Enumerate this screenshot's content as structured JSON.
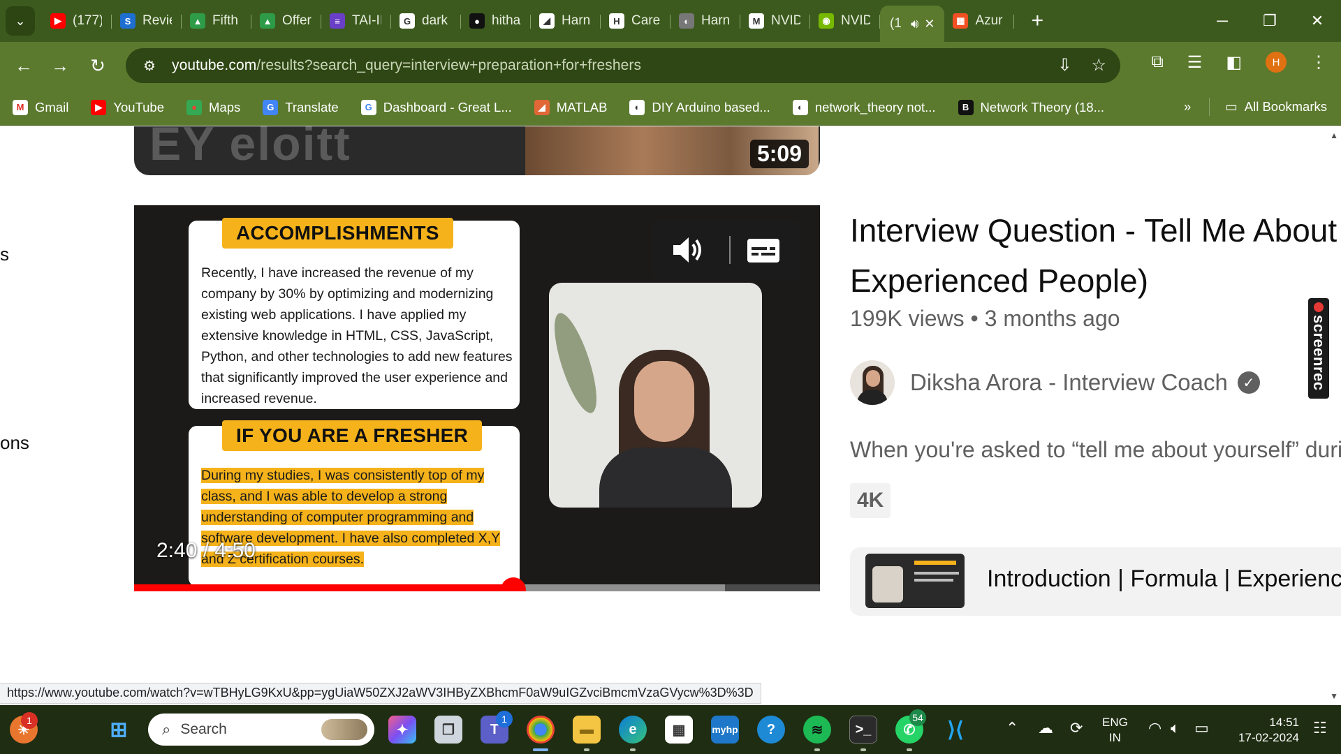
{
  "browser": {
    "tabs": [
      {
        "title": "(177)",
        "icon": "youtube-icon",
        "color": "#ff0000",
        "glyph": "▶"
      },
      {
        "title": "Revie",
        "icon": "s-logo-icon",
        "color": "#1f6fd1",
        "glyph": "S"
      },
      {
        "title": "Fifth",
        "icon": "drive-icon",
        "color": "#2d9b48",
        "glyph": "▲"
      },
      {
        "title": "Offer",
        "icon": "drive-icon",
        "color": "#2d9b48",
        "glyph": "▲"
      },
      {
        "title": "TAI-II",
        "icon": "forms-icon",
        "color": "#6a3fc7",
        "glyph": "≡"
      },
      {
        "title": "dark",
        "icon": "google-icon",
        "color": "#ffffff",
        "glyph": "G"
      },
      {
        "title": "hitha",
        "icon": "github-icon",
        "color": "#111111",
        "glyph": "●"
      },
      {
        "title": "Harn",
        "icon": "harness-icon",
        "color": "#ffffff",
        "glyph": "◢"
      },
      {
        "title": "Care",
        "icon": "h-logo-icon",
        "color": "#ffffff",
        "glyph": "H"
      },
      {
        "title": "Harn",
        "icon": "globe-icon",
        "color": "#777777",
        "glyph": "◐"
      },
      {
        "title": "NVID",
        "icon": "gmail-icon",
        "color": "#ffffff",
        "glyph": "M"
      },
      {
        "title": "NVID",
        "icon": "nvidia-icon",
        "color": "#76b900",
        "glyph": "◉"
      },
      {
        "title": "(1",
        "icon": "speaker-icon",
        "color": "#5b7a2e",
        "glyph": "",
        "active": true
      },
      {
        "title": "Azur",
        "icon": "microsoft-icon",
        "color": "#f25022",
        "glyph": "▦"
      }
    ],
    "url_host": "youtube.com",
    "url_path": "/results?search_query=interview+preparation+for+freshers",
    "bookmarks": [
      {
        "label": "Gmail",
        "icon": "gmail-icon",
        "color": "#ffffff",
        "glyph": "M",
        "fg": "#d93025"
      },
      {
        "label": "YouTube",
        "icon": "youtube-icon",
        "color": "#ff0000",
        "glyph": "▶",
        "fg": "#ffffff"
      },
      {
        "label": "Maps",
        "icon": "maps-icon",
        "color": "#34a853",
        "glyph": "●",
        "fg": "#ea4335"
      },
      {
        "label": "Translate",
        "icon": "translate-icon",
        "color": "#4285f4",
        "glyph": "G",
        "fg": "#ffffff"
      },
      {
        "label": "Dashboard - Great L...",
        "icon": "google-icon",
        "color": "#ffffff",
        "glyph": "G",
        "fg": "#4285f4"
      },
      {
        "label": "MATLAB",
        "icon": "matlab-icon",
        "color": "#e16737",
        "glyph": "◢",
        "fg": "#ffffff"
      },
      {
        "label": "DIY Arduino based...",
        "icon": "globe-icon",
        "color": "#ffffff",
        "glyph": "◐",
        "fg": "#333333"
      },
      {
        "label": "network_theory not...",
        "icon": "globe-icon",
        "color": "#ffffff",
        "glyph": "◐",
        "fg": "#333333"
      },
      {
        "label": "Network Theory (18...",
        "icon": "b-logo-icon",
        "color": "#111111",
        "glyph": "B",
        "fg": "#ffffff"
      }
    ],
    "all_bookmarks": "All Bookmarks",
    "profile_initial": "H"
  },
  "page": {
    "edge_texts": [
      "s",
      "ons"
    ],
    "prev_duration": "5:09",
    "prev_thumb_text": "EY   eloitt",
    "player": {
      "card_a_label": "ACCOMPLISHMENTS",
      "card_a_text": "Recently, I have increased the revenue of my company by 30% by optimizing and modernizing existing web applications. I have applied my extensive knowledge in HTML, CSS, JavaScript, Python, and other technologies to add new features that significantly improved the user experience and increased revenue.",
      "card_b_label": "IF YOU ARE A FRESHER",
      "card_b_text": "During my studies, I was consistently top of my class, and I was able to develop a strong understanding of computer programming and software development. I have also completed X,Y and Z certification courses.",
      "current_time": "2:40",
      "separator": "/",
      "total_time": "4:50",
      "played_fraction": 0.553,
      "buffered_fraction": 0.862
    },
    "video": {
      "title": "Interview Question - Tell Me About Yourself (Freshers &",
      "title_line2": "Experienced People)",
      "views": "199K views",
      "dot": "•",
      "age": "3 months ago",
      "channel": "Diksha Arora - Interview Coach",
      "description": "When you're asked to “tell me about yourself” during an interview",
      "badge": "4K",
      "chapter_title": "Introduction | Formula | Experience"
    },
    "screenrec": "screenrec"
  },
  "status_url": "https://www.youtube.com/watch?v=wTBHyLG9KxU&pp=ygUiaW50ZXJ2aWV3IHByZXBhcmF0aW9uIGZvciBmcmVzaGVycw%3D%3D",
  "taskbar": {
    "search_placeholder": "Search",
    "lang_top": "ENG",
    "lang_bottom": "IN",
    "time": "14:51",
    "date": "17-02-2024",
    "weather_badge": "1",
    "teams_badge": "1",
    "whatsapp_badge": "54"
  }
}
